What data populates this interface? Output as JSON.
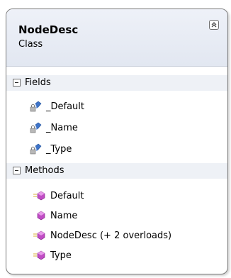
{
  "class": {
    "name": "NodeDesc",
    "kind": "Class"
  },
  "fields": {
    "label": "Fields",
    "items": [
      "_Default",
      "_Name",
      "_Type"
    ]
  },
  "methods": {
    "label": "Methods",
    "items": [
      "Default",
      "Name",
      "NodeDesc (+ 2 overloads)",
      "Type"
    ]
  },
  "icons": {
    "collapse": "double-chevron-up-icon",
    "section_toggle": "minus-box-icon",
    "field": "private-field-icon",
    "method": "public-method-icon",
    "private_method": "private-method-icon"
  },
  "colors": {
    "header_bg": "#e8ecf4",
    "border": "#7a7a7a",
    "field_icon": "#3f74c8",
    "method_icon": "#c04cc4"
  }
}
